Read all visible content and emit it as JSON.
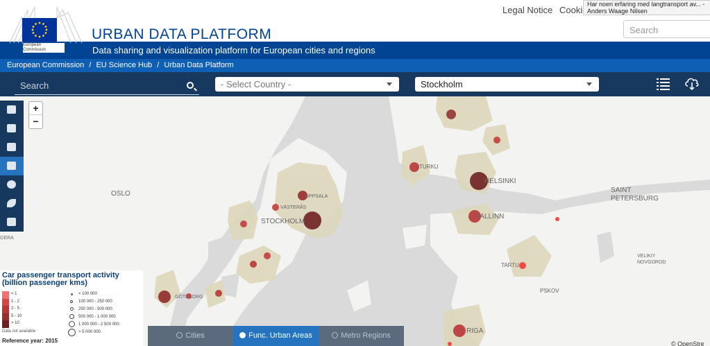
{
  "header": {
    "logo_text": "European Commission",
    "site_title": "URBAN DATA PLATFORM",
    "legal_notice": "Legal Notice",
    "cookies": "Cookie",
    "search_placeholder": "Search",
    "notification_line1": "Har noen erfaring med langtransport av... -",
    "notification_line2": "Anders Waage Nilsen"
  },
  "subtitle": "Data sharing and visualization platform for European cities and regions",
  "breadcrumb": [
    "European Commission",
    "/",
    "EU Science Hub",
    "/",
    "Urban Data Platform"
  ],
  "toolbar": {
    "search_placeholder": "Search",
    "country_select": "- Select Country -",
    "city_select": "Stockholm"
  },
  "map_labels": {
    "oslo": "OSLO",
    "stockholm": "STOCKHOLM",
    "uppsala": "UPPSALA",
    "vasteras": "VÄSTERÅS",
    "turku": "TURKU",
    "helsinki": "HELSINKI",
    "tallinn": "TALLINN",
    "saint_petersburg_1": "SAINT",
    "saint_petersburg_2": "PETERSBURG",
    "velikiy_1": "VELIKIY",
    "velikiy_2": "NOVGOROD",
    "tartu": "TARTU",
    "pskov": "PSKOV",
    "riga": "RIGA",
    "goteborg": "GÖTEBORG",
    "gera": "GERA"
  },
  "legend": {
    "title": "Car passenger transport activity (billion passenger kms)",
    "color_classes": [
      "< 1",
      "1 - 2",
      "2 - 5",
      "5 - 10",
      "> 10"
    ],
    "colors": [
      "#f27070",
      "#d94545",
      "#b83636",
      "#962c2c",
      "#6e2020"
    ],
    "not_available": "Data not available",
    "size_classes": [
      "< 100 000",
      "100 000 - 250 000",
      "250 000 - 500 000",
      "500 000 - 1 000 000",
      "1 000 000 - 2 500 000",
      "> 5 000 000"
    ],
    "reference_year": "Reference year: 2015"
  },
  "tabs": [
    {
      "label": "Cities",
      "active": false
    },
    {
      "label": "Func. Urban Areas",
      "active": true
    },
    {
      "label": "Metro Regions",
      "active": false
    }
  ],
  "attribution": "© OpenStre",
  "zoom": {
    "in": "+",
    "out": "−"
  },
  "accent_color": "#004494"
}
